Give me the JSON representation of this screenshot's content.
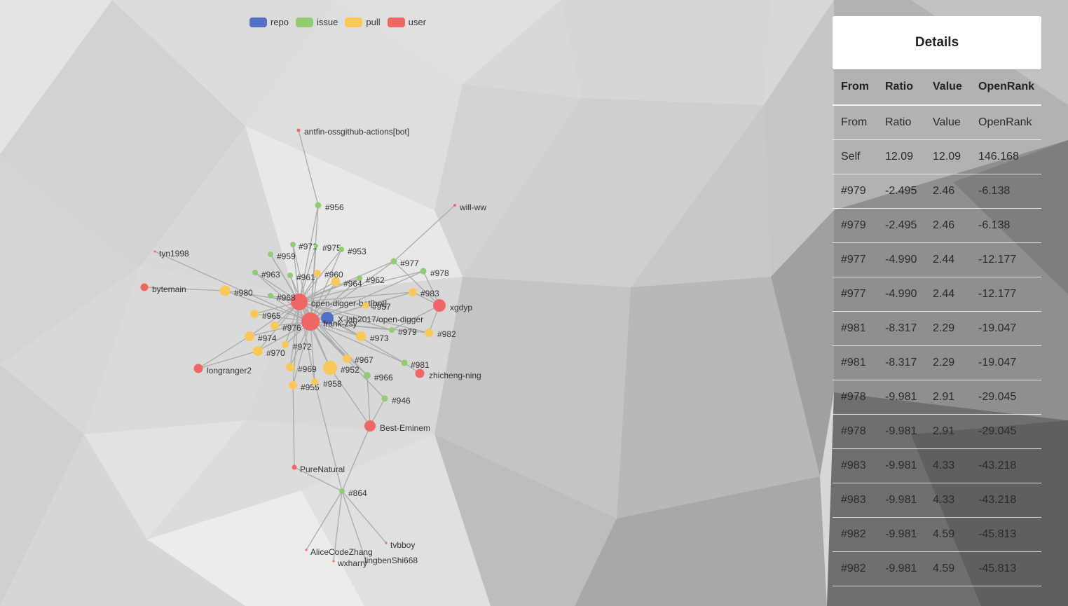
{
  "legend": [
    {
      "label": "repo",
      "color": "#5470c6"
    },
    {
      "label": "issue",
      "color": "#91cc75"
    },
    {
      "label": "pull",
      "color": "#fac858"
    },
    {
      "label": "user",
      "color": "#ee6666"
    }
  ],
  "details": {
    "title": "Details",
    "columns": [
      "From",
      "Ratio",
      "Value",
      "OpenRank"
    ],
    "rows": [
      [
        "From",
        "Ratio",
        "Value",
        "OpenRank"
      ],
      [
        "Self",
        "12.09",
        "12.09",
        "146.168"
      ],
      [
        "#979",
        "-2.495",
        "2.46",
        "-6.138"
      ],
      [
        "#979",
        "-2.495",
        "2.46",
        "-6.138"
      ],
      [
        "#977",
        "-4.990",
        "2.44",
        "-12.177"
      ],
      [
        "#977",
        "-4.990",
        "2.44",
        "-12.177"
      ],
      [
        "#981",
        "-8.317",
        "2.29",
        "-19.047"
      ],
      [
        "#981",
        "-8.317",
        "2.29",
        "-19.047"
      ],
      [
        "#978",
        "-9.981",
        "2.91",
        "-29.045"
      ],
      [
        "#978",
        "-9.981",
        "2.91",
        "-29.045"
      ],
      [
        "#983",
        "-9.981",
        "4.33",
        "-43.218"
      ],
      [
        "#983",
        "-9.981",
        "4.33",
        "-43.218"
      ],
      [
        "#982",
        "-9.981",
        "4.59",
        "-45.813"
      ],
      [
        "#982",
        "-9.981",
        "4.59",
        "-45.813"
      ]
    ]
  },
  "graph": {
    "nodes": [
      {
        "id": "X-lab2017/open-digger",
        "type": "repo"
      },
      {
        "id": "frank-zsy",
        "type": "user"
      },
      {
        "id": "open-digger-bot[bot]",
        "type": "user"
      },
      {
        "id": "antfin-ossgithub-actions[bot]",
        "type": "user"
      },
      {
        "id": "will-ww",
        "type": "user"
      },
      {
        "id": "tyn1998",
        "type": "user"
      },
      {
        "id": "bytemain",
        "type": "user"
      },
      {
        "id": "longranger2",
        "type": "user"
      },
      {
        "id": "xgdyp",
        "type": "user"
      },
      {
        "id": "zhicheng-ning",
        "type": "user"
      },
      {
        "id": "Best-Eminem",
        "type": "user"
      },
      {
        "id": "PureNatural",
        "type": "user"
      },
      {
        "id": "AliceCodeZhang",
        "type": "user"
      },
      {
        "id": "tvbboy",
        "type": "user"
      },
      {
        "id": "wxharry",
        "type": "user"
      },
      {
        "id": "lingbenShi668",
        "type": "user"
      },
      {
        "id": "#956",
        "type": "issue"
      },
      {
        "id": "#971",
        "type": "issue"
      },
      {
        "id": "#975",
        "type": "issue"
      },
      {
        "id": "#953",
        "type": "issue"
      },
      {
        "id": "#959",
        "type": "issue"
      },
      {
        "id": "#963",
        "type": "issue"
      },
      {
        "id": "#961",
        "type": "issue"
      },
      {
        "id": "#962",
        "type": "issue"
      },
      {
        "id": "#977",
        "type": "issue"
      },
      {
        "id": "#978",
        "type": "issue"
      },
      {
        "id": "#968",
        "type": "issue"
      },
      {
        "id": "#979",
        "type": "issue"
      },
      {
        "id": "#981",
        "type": "issue"
      },
      {
        "id": "#966",
        "type": "issue"
      },
      {
        "id": "#946",
        "type": "issue"
      },
      {
        "id": "#864",
        "type": "issue"
      },
      {
        "id": "#960",
        "type": "pull"
      },
      {
        "id": "#964",
        "type": "pull"
      },
      {
        "id": "#980",
        "type": "pull"
      },
      {
        "id": "#983",
        "type": "pull"
      },
      {
        "id": "#957",
        "type": "pull"
      },
      {
        "id": "#965",
        "type": "pull"
      },
      {
        "id": "#976",
        "type": "pull"
      },
      {
        "id": "#974",
        "type": "pull"
      },
      {
        "id": "#970",
        "type": "pull"
      },
      {
        "id": "#972",
        "type": "pull"
      },
      {
        "id": "#973",
        "type": "pull"
      },
      {
        "id": "#982",
        "type": "pull"
      },
      {
        "id": "#967",
        "type": "pull"
      },
      {
        "id": "#969",
        "type": "pull"
      },
      {
        "id": "#952",
        "type": "pull"
      },
      {
        "id": "#955",
        "type": "pull"
      },
      {
        "id": "#958",
        "type": "pull"
      }
    ],
    "links": [
      [
        "frank-zsy",
        "X-lab2017/open-digger"
      ],
      [
        "open-digger-bot[bot]",
        "X-lab2017/open-digger"
      ],
      [
        "antfin-ossgithub-actions[bot]",
        "#956"
      ],
      [
        "#956",
        "frank-zsy"
      ],
      [
        "#956",
        "open-digger-bot[bot]"
      ],
      [
        "will-ww",
        "#977"
      ],
      [
        "tyn1998",
        "frank-zsy"
      ],
      [
        "bytemain",
        "#980"
      ],
      [
        "#980",
        "frank-zsy"
      ],
      [
        "#980",
        "open-digger-bot[bot]"
      ],
      [
        "longranger2",
        "#970"
      ],
      [
        "longranger2",
        "#974"
      ],
      [
        "xgdyp",
        "#983"
      ],
      [
        "xgdyp",
        "#978"
      ],
      [
        "xgdyp",
        "#982"
      ],
      [
        "xgdyp",
        "#979"
      ],
      [
        "xgdyp",
        "#977"
      ],
      [
        "zhicheng-ning",
        "#981"
      ],
      [
        "Best-Eminem",
        "#946"
      ],
      [
        "Best-Eminem",
        "#966"
      ],
      [
        "Best-Eminem",
        "#952"
      ],
      [
        "PureNatural",
        "#955"
      ],
      [
        "#864",
        "#958"
      ],
      [
        "#864",
        "PureNatural"
      ],
      [
        "#864",
        "Best-Eminem"
      ],
      [
        "AliceCodeZhang",
        "#864"
      ],
      [
        "tvbboy",
        "#864"
      ],
      [
        "wxharry",
        "#864"
      ],
      [
        "lingbenShi668",
        "#864"
      ],
      [
        "#971",
        "frank-zsy"
      ],
      [
        "#975",
        "frank-zsy"
      ],
      [
        "#953",
        "frank-zsy"
      ],
      [
        "#959",
        "frank-zsy"
      ],
      [
        "#963",
        "frank-zsy"
      ],
      [
        "#961",
        "frank-zsy"
      ],
      [
        "#962",
        "frank-zsy"
      ],
      [
        "#977",
        "frank-zsy"
      ],
      [
        "#978",
        "frank-zsy"
      ],
      [
        "#968",
        "frank-zsy"
      ],
      [
        "#979",
        "frank-zsy"
      ],
      [
        "#981",
        "frank-zsy"
      ],
      [
        "#966",
        "frank-zsy"
      ],
      [
        "#946",
        "frank-zsy"
      ],
      [
        "#960",
        "frank-zsy"
      ],
      [
        "#964",
        "frank-zsy"
      ],
      [
        "#983",
        "frank-zsy"
      ],
      [
        "#957",
        "frank-zsy"
      ],
      [
        "#965",
        "frank-zsy"
      ],
      [
        "#976",
        "frank-zsy"
      ],
      [
        "#974",
        "frank-zsy"
      ],
      [
        "#970",
        "frank-zsy"
      ],
      [
        "#972",
        "frank-zsy"
      ],
      [
        "#973",
        "frank-zsy"
      ],
      [
        "#982",
        "frank-zsy"
      ],
      [
        "#967",
        "frank-zsy"
      ],
      [
        "#969",
        "frank-zsy"
      ],
      [
        "#952",
        "frank-zsy"
      ],
      [
        "#955",
        "frank-zsy"
      ],
      [
        "#958",
        "frank-zsy"
      ],
      [
        "#971",
        "open-digger-bot[bot]"
      ],
      [
        "#959",
        "open-digger-bot[bot]"
      ],
      [
        "#963",
        "open-digger-bot[bot]"
      ],
      [
        "#961",
        "open-digger-bot[bot]"
      ],
      [
        "#962",
        "open-digger-bot[bot]"
      ],
      [
        "#977",
        "open-digger-bot[bot]"
      ],
      [
        "#978",
        "open-digger-bot[bot]"
      ],
      [
        "#968",
        "open-digger-bot[bot]"
      ],
      [
        "#979",
        "open-digger-bot[bot]"
      ],
      [
        "#981",
        "open-digger-bot[bot]"
      ],
      [
        "#965",
        "open-digger-bot[bot]"
      ],
      [
        "#976",
        "open-digger-bot[bot]"
      ],
      [
        "#974",
        "open-digger-bot[bot]"
      ],
      [
        "#970",
        "open-digger-bot[bot]"
      ],
      [
        "#973",
        "open-digger-bot[bot]"
      ],
      [
        "#967",
        "open-digger-bot[bot]"
      ],
      [
        "#969",
        "open-digger-bot[bot]"
      ],
      [
        "#952",
        "open-digger-bot[bot]"
      ],
      [
        "#955",
        "open-digger-bot[bot]"
      ],
      [
        "#958",
        "open-digger-bot[bot]"
      ],
      [
        "#964",
        "open-digger-bot[bot]"
      ],
      [
        "#960",
        "open-digger-bot[bot]"
      ],
      [
        "#975",
        "open-digger-bot[bot]"
      ],
      [
        "#953",
        "open-digger-bot[bot]"
      ],
      [
        "#983",
        "open-digger-bot[bot]"
      ],
      [
        "#982",
        "open-digger-bot[bot]"
      ],
      [
        "#972",
        "open-digger-bot[bot]"
      ],
      [
        "#966",
        "open-digger-bot[bot]"
      ]
    ]
  }
}
